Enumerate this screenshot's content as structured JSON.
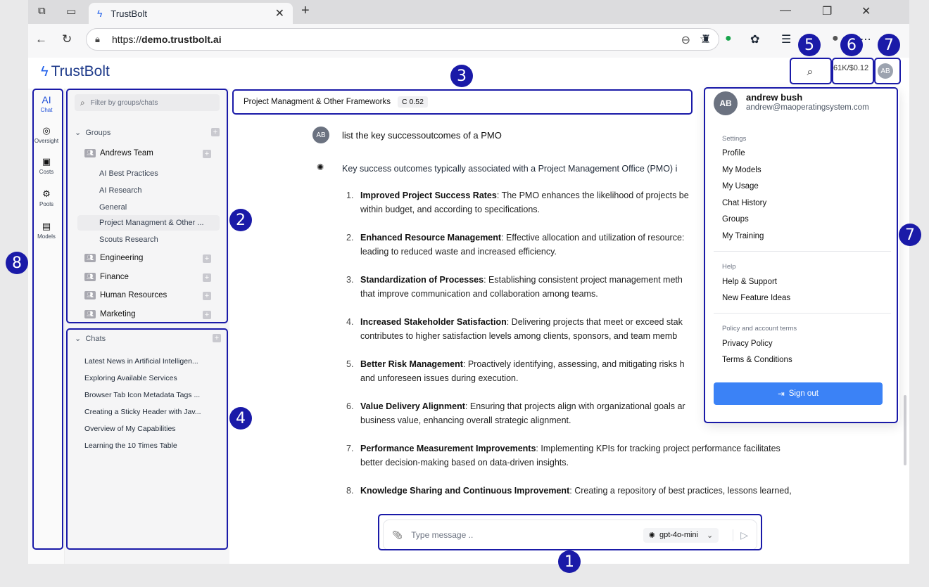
{
  "browser": {
    "tab_title": "TrustBolt",
    "url_prefix": "https://",
    "url_domain": "demo.trustbolt.ai"
  },
  "header": {
    "brand": "TrustBolt",
    "usage": "61K/$0.12",
    "avatar_initials": "AB"
  },
  "rail": {
    "items": [
      {
        "glyph": "AI",
        "label": "Chat"
      },
      {
        "glyph": "◎",
        "label": "Oversight"
      },
      {
        "glyph": "▣",
        "label": "Costs"
      },
      {
        "glyph": "⚙",
        "label": "Pools"
      },
      {
        "glyph": "▤",
        "label": "Models"
      }
    ]
  },
  "sidebar": {
    "filter_placeholder": "Filter by groups/chats",
    "groups_header": "Groups",
    "groups": [
      {
        "name": "Andrews Team"
      },
      {
        "name": "Engineering"
      },
      {
        "name": "Finance"
      },
      {
        "name": "Human Resources"
      },
      {
        "name": "Marketing"
      }
    ],
    "channels": [
      "AI Best Practices",
      "AI Research",
      "General",
      "Project Managment & Other ...",
      "Scouts Research"
    ],
    "chats_header": "Chats",
    "chats": [
      "Latest News in Artificial Intelligen...",
      "Exploring Available Services",
      "Browser Tab Icon Metadata Tags ...",
      "Creating a Sticky Header with Jav...",
      "Overview of My Capabilities",
      "Learning the 10 Times Table"
    ]
  },
  "conversation": {
    "title": "Project Managment & Other Frameworks",
    "cost": "C 0.52",
    "user_initials": "AB",
    "user_message": "list the key successoutcomes of a PMO",
    "ai_intro": "Key success outcomes typically associated with a Project Management Office (PMO) i",
    "items": [
      {
        "num": "1.",
        "bold": "Improved Project Success Rates",
        "line1": ": The PMO enhances the likelihood of projects be",
        "line2": "within budget, and according to specifications."
      },
      {
        "num": "2.",
        "bold": "Enhanced Resource Management",
        "line1": ": Effective allocation and utilization of resource:",
        "line2": "leading to reduced waste and increased efficiency."
      },
      {
        "num": "3.",
        "bold": "Standardization of Processes",
        "line1": ": Establishing consistent project management meth",
        "line2": "that improve communication and collaboration among teams."
      },
      {
        "num": "4.",
        "bold": "Increased Stakeholder Satisfaction",
        "line1": ": Delivering projects that meet or exceed stak",
        "line2": "contributes to higher satisfaction levels among clients, sponsors, and team memb"
      },
      {
        "num": "5.",
        "bold": "Better Risk Management",
        "line1": ": Proactively identifying, assessing, and mitigating risks h",
        "line2": "and unforeseen issues during execution."
      },
      {
        "num": "6.",
        "bold": "Value Delivery Alignment",
        "line1": ": Ensuring that projects align with organizational goals ar",
        "line2": "business value, enhancing overall strategic alignment."
      },
      {
        "num": "7.",
        "bold": "Performance Measurement Improvements",
        "line1": ": Implementing KPIs for tracking project performance facilitates",
        "line2": "better decision-making based on data-driven insights."
      },
      {
        "num": "8.",
        "bold": "Knowledge Sharing and Continuous Improvement",
        "line1": ": Creating a repository of best practices, lessons learned,",
        "line2": ""
      }
    ]
  },
  "composer": {
    "placeholder": "Type message ..",
    "model": "gpt-4o-mini"
  },
  "user_menu": {
    "initials": "AB",
    "name": "andrew bush",
    "email": "andrew@maoperatingsystem.com",
    "settings_caption": "Settings",
    "settings_items": [
      "Profile",
      "My Models",
      "My Usage",
      "Chat History",
      "Groups",
      "My Training"
    ],
    "help_caption": "Help",
    "help_items": [
      "Help & Support",
      "New Feature Ideas"
    ],
    "policy_caption": "Policy and account terms",
    "policy_items": [
      "Privacy Policy",
      "Terms & Conditions"
    ],
    "sign_out": "Sign out"
  },
  "annotations": [
    "1",
    "2",
    "3",
    "4",
    "5",
    "6",
    "7",
    "7",
    "8"
  ]
}
